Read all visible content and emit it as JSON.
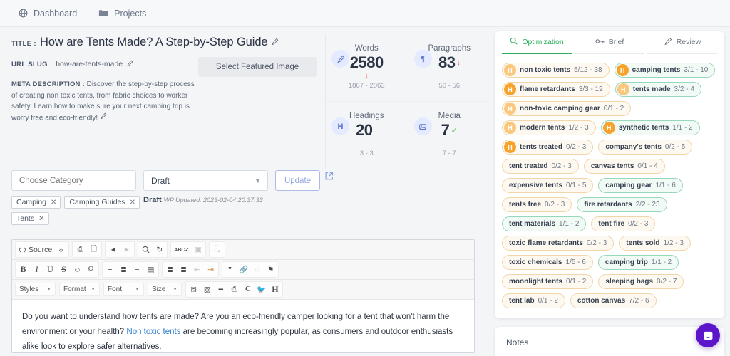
{
  "nav": {
    "items": [
      {
        "label": "Dashboard",
        "icon": "globe-icon"
      },
      {
        "label": "Projects",
        "icon": "folder-icon"
      }
    ]
  },
  "meta": {
    "title_label": "TITLE :",
    "title": "How are Tents Made? A Step-by-Step Guide",
    "slug_label": "URL SLUG :",
    "slug": "how-are-tents-made",
    "desc_label": "META DESCRIPTION :",
    "desc": " Discover the step-by-step process of creating non toxic tents, from fabric choices to worker safety. Learn how to make sure your next camping trip is worry free and eco-friendly!",
    "featured_button": "Select Featured Image"
  },
  "controls": {
    "category_placeholder": "Choose Category",
    "chips": [
      "Camping",
      "Camping Guides",
      "Tents"
    ],
    "status_value": "Draft",
    "draft_state": "Draft",
    "draft_updated": "WP Updated: 2023-02-04 20:37:33",
    "update_label": "Update",
    "open_icon": "external-link-icon"
  },
  "editor": {
    "row1": [
      {
        "label": "Source",
        "icon": "source-icon"
      },
      {
        "label": "<>",
        "icon": "code-icon"
      },
      {
        "label": "⎘",
        "icon": "paste-icon"
      },
      {
        "label": "⎆",
        "icon": "paste-word-icon"
      },
      {
        "label": "◀",
        "icon": "undo-icon"
      },
      {
        "label": "▶",
        "icon": "redo-icon",
        "dim": true
      },
      {
        "label": "⌕",
        "icon": "search-icon"
      },
      {
        "label": "↻",
        "icon": "replace-icon"
      },
      {
        "label": "ABC",
        "icon": "spellcheck-icon"
      },
      {
        "label": "▣",
        "icon": "template-icon",
        "dim": true
      },
      {
        "label": "⛶",
        "icon": "maximize-icon"
      }
    ],
    "row2": [
      {
        "label": "B",
        "icon": "bold-icon"
      },
      {
        "label": "I",
        "icon": "italic-icon"
      },
      {
        "label": "U",
        "icon": "underline-icon"
      },
      {
        "label": "S",
        "icon": "strikethrough-icon"
      },
      {
        "label": "☺",
        "icon": "smiley-icon"
      },
      {
        "label": "Ω",
        "icon": "special-char-icon"
      },
      {
        "label": "≡",
        "icon": "align-left-icon"
      },
      {
        "label": "≣",
        "icon": "align-center-icon"
      },
      {
        "label": "≡",
        "icon": "align-right-icon"
      },
      {
        "label": "☰",
        "icon": "justify-icon"
      },
      {
        "label": "☷",
        "icon": "numbered-list-icon"
      },
      {
        "label": "☲",
        "icon": "bullet-list-icon"
      },
      {
        "label": "⇤",
        "icon": "outdent-icon",
        "dim": true
      },
      {
        "label": "⇥",
        "icon": "indent-icon"
      },
      {
        "label": "”",
        "icon": "blockquote-icon"
      },
      {
        "label": "⚭",
        "icon": "link-icon"
      },
      {
        "label": "◌",
        "icon": "unlink-icon",
        "dim": true
      },
      {
        "label": "⚑",
        "icon": "anchor-icon"
      }
    ],
    "selects": [
      {
        "label": "Styles"
      },
      {
        "label": "Format"
      },
      {
        "label": "Font"
      },
      {
        "label": "Size"
      }
    ],
    "row3": [
      {
        "label": "⛰",
        "icon": "image-icon"
      },
      {
        "label": "⌸",
        "icon": "table-icon"
      },
      {
        "label": "━",
        "icon": "horizontal-rule-icon"
      },
      {
        "label": "⎙",
        "icon": "page-break-icon"
      },
      {
        "label": "C",
        "icon": "refresh-icon"
      },
      {
        "label": "✓",
        "icon": "twitter-icon"
      },
      {
        "label": "H",
        "icon": "heading-icon"
      }
    ],
    "content_before_link": "Do you want to understand how tents are made? Are you an eco-friendly camper looking for a tent that won't harm the environment or your health? ",
    "content_link": "Non toxic tents",
    "content_after_link": " are becoming increasingly popular, as consumers and outdoor enthusiasts alike look to explore safer alternatives."
  },
  "stats": [
    {
      "name": "Words",
      "value": "2580",
      "range": "1867 - 2063",
      "icon": "pen-icon",
      "icon_glyph": "✎",
      "status": "below",
      "status_glyph": "↓",
      "arrow_below": true
    },
    {
      "name": "Paragraphs",
      "value": "83",
      "range": "50 - 56",
      "icon": "paragraph-icon",
      "icon_glyph": "¶",
      "status": "below",
      "status_glyph": "↓",
      "arrow_below": false
    },
    {
      "name": "Headings",
      "value": "20",
      "range": "3 - 3",
      "icon": "heading-icon",
      "icon_glyph": "H",
      "status": "below",
      "status_glyph": "↓",
      "arrow_below": false
    },
    {
      "name": "Media",
      "value": "7",
      "range": "7 - 7",
      "icon": "media-icon",
      "icon_glyph": "▣",
      "status": "ok",
      "status_glyph": "✓",
      "arrow_below": false
    }
  ],
  "right_panel": {
    "tabs": [
      {
        "label": "Optimization",
        "icon": "search-icon",
        "active": true
      },
      {
        "label": "Brief",
        "icon": "key-icon",
        "active": false
      },
      {
        "label": "Review",
        "icon": "pen-icon",
        "active": false
      }
    ],
    "tags": [
      {
        "text": "non toxic tents",
        "count": "5/12 - 38",
        "badge": "H",
        "badge_pale": true,
        "green": false
      },
      {
        "text": "camping tents",
        "count": "3/1 - 10",
        "badge": "H",
        "badge_pale": false,
        "green": true
      },
      {
        "text": "flame retardants",
        "count": "3/3 - 19",
        "badge": "H",
        "badge_pale": false,
        "green": false
      },
      {
        "text": "tents made",
        "count": "3/2 - 4",
        "badge": "H",
        "badge_pale": true,
        "green": true
      },
      {
        "text": "non-toxic camping gear",
        "count": "0/1 - 2",
        "badge": "H",
        "badge_pale": true,
        "green": false
      },
      {
        "text": "modern tents",
        "count": "1/2 - 3",
        "badge": "H",
        "badge_pale": true,
        "green": false
      },
      {
        "text": "synthetic tents",
        "count": "1/1 - 2",
        "badge": "H",
        "badge_pale": false,
        "green": true
      },
      {
        "text": "tents treated",
        "count": "0/2 - 3",
        "badge": "H",
        "badge_pale": false,
        "green": false
      },
      {
        "text": "company's tents",
        "count": "0/2 - 5",
        "badge": null,
        "green": false
      },
      {
        "text": "tent treated",
        "count": "0/2 - 3",
        "badge": null,
        "green": false
      },
      {
        "text": "canvas tents",
        "count": "0/1 - 4",
        "badge": null,
        "green": false
      },
      {
        "text": "expensive tents",
        "count": "0/1 - 5",
        "badge": null,
        "green": false
      },
      {
        "text": "camping gear",
        "count": "1/1 - 6",
        "badge": null,
        "green": true
      },
      {
        "text": "tents free",
        "count": "0/2 - 3",
        "badge": null,
        "green": false
      },
      {
        "text": "fire retardants",
        "count": "2/2 - 23",
        "badge": null,
        "green": true
      },
      {
        "text": "tent materials",
        "count": "1/1 - 2",
        "badge": null,
        "green": true
      },
      {
        "text": "tent fire",
        "count": "0/2 - 3",
        "badge": null,
        "green": false
      },
      {
        "text": "toxic flame retardants",
        "count": "0/2 - 3",
        "badge": null,
        "green": false
      },
      {
        "text": "tents sold",
        "count": "1/2 - 3",
        "badge": null,
        "green": false
      },
      {
        "text": "toxic chemicals",
        "count": "1/5 - 6",
        "badge": null,
        "green": false
      },
      {
        "text": "camping trip",
        "count": "1/1 - 2",
        "badge": null,
        "green": true
      },
      {
        "text": "moonlight tents",
        "count": "0/1 - 2",
        "badge": null,
        "green": false
      },
      {
        "text": "sleeping bags",
        "count": "0/2 - 7",
        "badge": null,
        "green": false
      },
      {
        "text": "tent lab",
        "count": "0/1 - 2",
        "badge": null,
        "green": false
      },
      {
        "text": "cotton canvas",
        "count": "7/2 - 6",
        "badge": null,
        "green": false
      }
    ],
    "notes_title": "Notes"
  },
  "chat": {
    "icon": "chat-bubble-icon",
    "color": "#5b16c9"
  }
}
